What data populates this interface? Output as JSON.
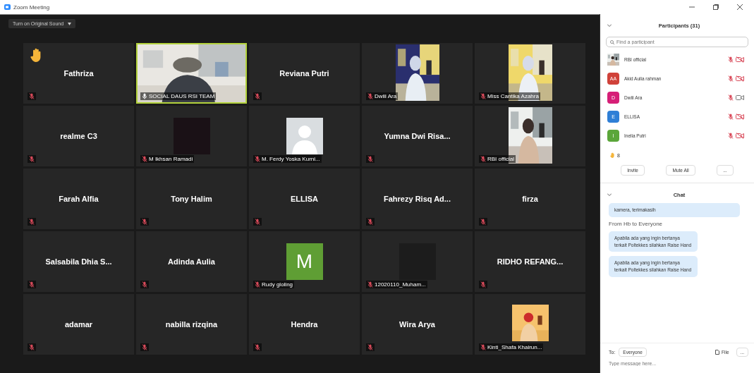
{
  "window": {
    "title": "Zoom Meeting"
  },
  "toolbar": {
    "dropdown": "Turn on Original Sound"
  },
  "tiles": [
    {
      "kind": "name",
      "name": "Fathriza",
      "muted": true,
      "hand_raised": true,
      "speaking": false
    },
    {
      "kind": "video",
      "label": "SOCIAL DAUS RSI TEAM",
      "muted": false,
      "hand_raised": false,
      "speaking": true
    },
    {
      "kind": "name",
      "name": "Reviana Putri",
      "muted": true,
      "hand_raised": false,
      "speaking": false
    },
    {
      "kind": "video",
      "label": "Dwiii Ara",
      "muted": true,
      "hand_raised": false,
      "speaking": false
    },
    {
      "kind": "video",
      "label": "Miss Cantika Azahra",
      "muted": true,
      "hand_raised": false,
      "speaking": false
    },
    {
      "kind": "name",
      "name": "realme C3",
      "muted": true,
      "hand_raised": false,
      "speaking": false
    },
    {
      "kind": "blank",
      "label": "M Ikhsan Ramadi",
      "muted": true,
      "hand_raised": false,
      "speaking": false
    },
    {
      "kind": "silhouette",
      "label": "M. Ferdy Yoska Kurni...",
      "muted": true,
      "hand_raised": false,
      "speaking": false
    },
    {
      "kind": "name",
      "name": "Yumna Dwi Risa...",
      "muted": true,
      "hand_raised": false,
      "speaking": false
    },
    {
      "kind": "video",
      "label": "RBI official",
      "muted": true,
      "hand_raised": false,
      "speaking": false
    },
    {
      "kind": "name",
      "name": "Farah Alfia",
      "muted": true,
      "hand_raised": false,
      "speaking": false
    },
    {
      "kind": "name",
      "name": "Tony Halim",
      "muted": true,
      "hand_raised": false,
      "speaking": false
    },
    {
      "kind": "name",
      "name": "ELLISA",
      "muted": true,
      "hand_raised": false,
      "speaking": false
    },
    {
      "kind": "name",
      "name": "Fahrezy Risq Ad...",
      "muted": true,
      "hand_raised": false,
      "speaking": false
    },
    {
      "kind": "name",
      "name": "firza",
      "muted": true,
      "hand_raised": false,
      "speaking": false
    },
    {
      "kind": "name",
      "name": "Salsabila Dhia S...",
      "muted": true,
      "hand_raised": false,
      "speaking": false
    },
    {
      "kind": "name",
      "name": "Adinda Aulia",
      "muted": true,
      "hand_raised": false,
      "speaking": false
    },
    {
      "kind": "letter",
      "letter": "M",
      "color": "#5f9e34",
      "label": "Rudy gloling",
      "muted": true,
      "hand_raised": false,
      "speaking": false
    },
    {
      "kind": "blank",
      "label": "12020110_Muham...",
      "muted": true,
      "hand_raised": false,
      "speaking": false
    },
    {
      "kind": "name",
      "name": "RIDHO REFANG...",
      "muted": true,
      "hand_raised": false,
      "speaking": false
    },
    {
      "kind": "name",
      "name": "adamar",
      "muted": true,
      "hand_raised": false,
      "speaking": false
    },
    {
      "kind": "name",
      "name": "nabilla rizqina",
      "muted": true,
      "hand_raised": false,
      "speaking": false
    },
    {
      "kind": "name",
      "name": "Hendra",
      "muted": true,
      "hand_raised": false,
      "speaking": false
    },
    {
      "kind": "name",
      "name": "Wira Arya",
      "muted": true,
      "hand_raised": false,
      "speaking": false
    },
    {
      "kind": "cartoon",
      "label": "Kinti_Shafa Khairun...",
      "muted": true,
      "hand_raised": false,
      "speaking": false
    }
  ],
  "participants": {
    "title": "Participants (31)",
    "search": {
      "placeholder": "Find a participant"
    },
    "items": [
      {
        "name": "RBI official",
        "muted": true,
        "video_on": false
      },
      {
        "kind": "letter",
        "letter": "AA",
        "color": "#d0423a",
        "name": "Akid Aulia rahman",
        "muted": true,
        "video_on": false
      },
      {
        "kind": "letter",
        "letter": "D",
        "color": "#d61f77",
        "name": "Dwiii Ara",
        "muted": true,
        "video_on": true
      },
      {
        "kind": "letter",
        "letter": "E",
        "color": "#2f7fd6",
        "name": "ELLISA",
        "muted": true,
        "video_on": false
      },
      {
        "kind": "letter",
        "letter": "I",
        "color": "#5ba63a",
        "name": "Inelia Putri",
        "muted": true,
        "video_on": false
      }
    ],
    "hand_count": "8",
    "buttons": [
      "Invite",
      "Mute All",
      "..."
    ]
  },
  "chat": {
    "title": "Chat",
    "items": [
      {
        "kind": "bubble",
        "text": "kamera, terimakasih"
      },
      {
        "kind": "sender",
        "text": "From Hb to Everyone"
      },
      {
        "kind": "bubble",
        "text": "Apabila ada yang ingin bertanya terkait Poltekkes silahkan Raise Hand"
      },
      {
        "kind": "bubble",
        "text": "Apabila ada yang ingin bertanya terkait Poltekkes silahkan Raise Hand"
      }
    ],
    "to_label": "To:",
    "recipient": "Everyone",
    "file_button": "File",
    "more_button": "...",
    "input": {
      "placeholder": "Type message here..."
    }
  }
}
